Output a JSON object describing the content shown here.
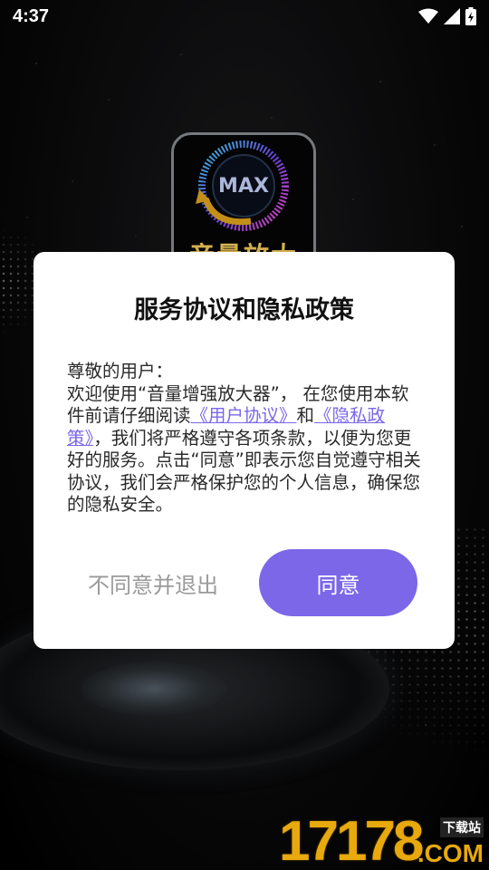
{
  "status_bar": {
    "time": "4:37"
  },
  "background_app": {
    "icon_badge_text": "MAX",
    "icon_caption": "音量放大"
  },
  "dialog": {
    "title": "服务协议和隐私政策",
    "greeting": "尊敬的用户：",
    "body_part1": "欢迎使用“音量增强放大器”， 在您使用本软件前请仔细阅读",
    "link_user_agreement": "《用户协议》",
    "conjunction": "和",
    "link_privacy_policy": "《隐私政策》",
    "body_part2": "，我们将严格遵守各项条款，以便为您更好的服务。点击“同意”即表示您自觉遵守相关协议，我们会严格保护您的个人信息，确保您的隐私安全。",
    "decline_label": "不同意并退出",
    "agree_label": "同意"
  },
  "watermark": {
    "number": "17178",
    "domain": ".COM",
    "badge": "下载站"
  },
  "colors": {
    "accent": "#7b67e8",
    "link": "#7b67e8",
    "decline_text": "#9a9a9a",
    "watermark": "#e7a90d"
  }
}
